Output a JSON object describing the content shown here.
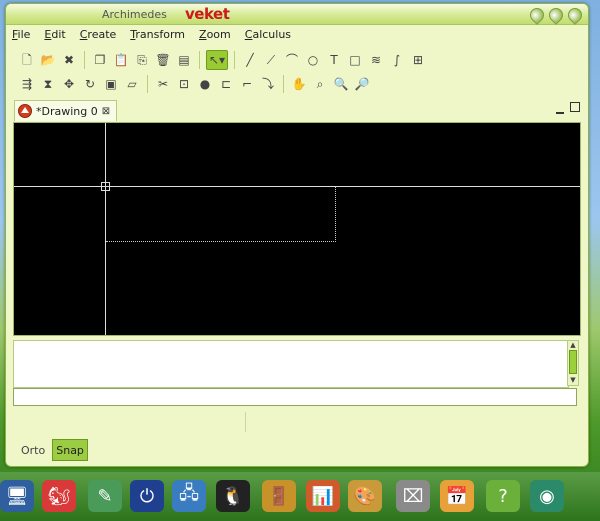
{
  "window": {
    "app_title": "Archimedes",
    "brand": "veket"
  },
  "menubar": [
    {
      "u": "F",
      "rest": "ile"
    },
    {
      "u": "E",
      "rest": "dit"
    },
    {
      "u": "C",
      "rest": "reate"
    },
    {
      "u": "T",
      "rest": "ransform"
    },
    {
      "u": "Z",
      "rest": "oom"
    },
    {
      "u": "C",
      "rest": "alculus"
    }
  ],
  "toolbar1": {
    "file": [
      {
        "name": "new-file-icon",
        "glyph": "🗋"
      },
      {
        "name": "open-folder-icon",
        "glyph": "📂"
      },
      {
        "name": "close-x-icon",
        "glyph": "✖"
      }
    ],
    "edit": [
      {
        "name": "copy-icon",
        "glyph": "❐"
      },
      {
        "name": "paste-icon",
        "glyph": "📋"
      },
      {
        "name": "clipboard-icon",
        "glyph": "⎘"
      },
      {
        "name": "delete-trash-icon",
        "glyph": "🗑"
      },
      {
        "name": "bin-icon",
        "glyph": "▤"
      }
    ],
    "select": {
      "name": "select-mode-icon",
      "glyph": "↖▾"
    },
    "draw": [
      {
        "name": "line-icon",
        "glyph": "╱"
      },
      {
        "name": "polyline-icon",
        "glyph": "⟋"
      },
      {
        "name": "arc-icon",
        "glyph": "⌒"
      },
      {
        "name": "circle-icon",
        "glyph": "○"
      },
      {
        "name": "text-tool-icon",
        "glyph": "T"
      },
      {
        "name": "rectangle-icon",
        "glyph": "□"
      },
      {
        "name": "hatch-icon",
        "glyph": "≋"
      },
      {
        "name": "spline-icon",
        "glyph": "∫"
      },
      {
        "name": "dimension-icon",
        "glyph": "⊞"
      }
    ]
  },
  "toolbar2": {
    "transform": [
      {
        "name": "align-icon",
        "glyph": "⇶"
      },
      {
        "name": "mirror-icon",
        "glyph": "⧗"
      },
      {
        "name": "move-icon",
        "glyph": "✥"
      },
      {
        "name": "rotate-icon",
        "glyph": "↻"
      },
      {
        "name": "scale-icon",
        "glyph": "▣"
      },
      {
        "name": "skew-icon",
        "glyph": "▱"
      }
    ],
    "modify": [
      {
        "name": "cut-scissors-icon",
        "glyph": "✂"
      },
      {
        "name": "trim-icon",
        "glyph": "⊡"
      },
      {
        "name": "fill-icon",
        "glyph": "●"
      },
      {
        "name": "offset-icon",
        "glyph": "⊏"
      },
      {
        "name": "fillet-icon",
        "glyph": "⌐"
      },
      {
        "name": "extend-icon",
        "glyph": "⤵"
      }
    ],
    "zoom": [
      {
        "name": "pan-hand-icon",
        "glyph": "✋"
      },
      {
        "name": "zoom-fit-icon",
        "glyph": "⌕"
      },
      {
        "name": "zoom-in-icon",
        "glyph": "🔍"
      },
      {
        "name": "zoom-out-icon",
        "glyph": "🔎"
      }
    ]
  },
  "tab": {
    "label": "*Drawing 0",
    "close": "⊠"
  },
  "command_line": {
    "value": ""
  },
  "status": {
    "ortho": "Orto",
    "snap": "Snap"
  },
  "taskbar": [
    {
      "name": "computer-icon",
      "color": "#2f5f9e",
      "glyph": "🖥"
    },
    {
      "name": "squirrel-browser-icon",
      "color": "#d83a3a",
      "glyph": "🐿"
    },
    {
      "name": "text-editor-icon",
      "color": "#4a9a5a",
      "glyph": "✎"
    },
    {
      "name": "media-player-icon",
      "color": "#1f3f8f",
      "glyph": "⏻"
    },
    {
      "name": "network-icon",
      "color": "#3a7cc0",
      "glyph": "🖧"
    },
    {
      "name": "penguin-icon",
      "color": "#222222",
      "glyph": "🐧"
    },
    {
      "name": "exit-door-icon",
      "color": "#c8922a",
      "glyph": "🚪"
    },
    {
      "name": "presentation-chart-icon",
      "color": "#d05a2a",
      "glyph": "📊"
    },
    {
      "name": "paint-palette-icon",
      "color": "#c89a3a",
      "glyph": "🎨"
    },
    {
      "name": "usb-drive-icon",
      "color": "#8a8a8a",
      "glyph": "⌧"
    },
    {
      "name": "calendar-icon",
      "color": "#e8a038",
      "glyph": "📅"
    },
    {
      "name": "help-question-icon",
      "color": "#6ab03a",
      "glyph": "?"
    },
    {
      "name": "webcam-icon",
      "color": "#2a8a6a",
      "glyph": "◉"
    }
  ]
}
